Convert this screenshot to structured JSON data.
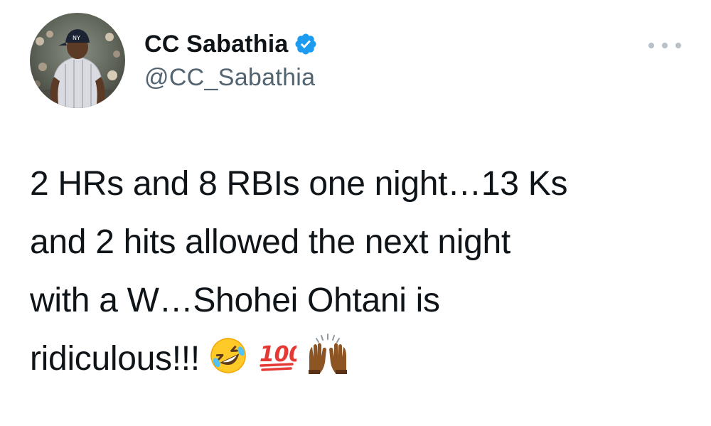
{
  "tweet": {
    "author": {
      "display_name": "CC Sabathia",
      "handle": "@CC_Sabathia",
      "verified": true,
      "avatar_icon": "profile-photo"
    },
    "more_icon": "more-dots-icon",
    "text_lines": [
      "2 HRs and 8 RBIs one night…13 Ks",
      "and 2 hits allowed the next night",
      "with a W…Shohei Ohtani is",
      "ridiculous!!!"
    ],
    "emojis": [
      {
        "name": "rolling-on-the-floor-laughing-emoji",
        "char": "🤣"
      },
      {
        "name": "hundred-points-emoji",
        "char": "💯"
      },
      {
        "name": "raising-hands-emoji",
        "char": "🙌🏾"
      }
    ],
    "colors": {
      "text": "#0f1419",
      "secondary_text": "#536471",
      "verified_badge": "#1d9bf0",
      "more_dots": "#b9c0c6"
    }
  }
}
